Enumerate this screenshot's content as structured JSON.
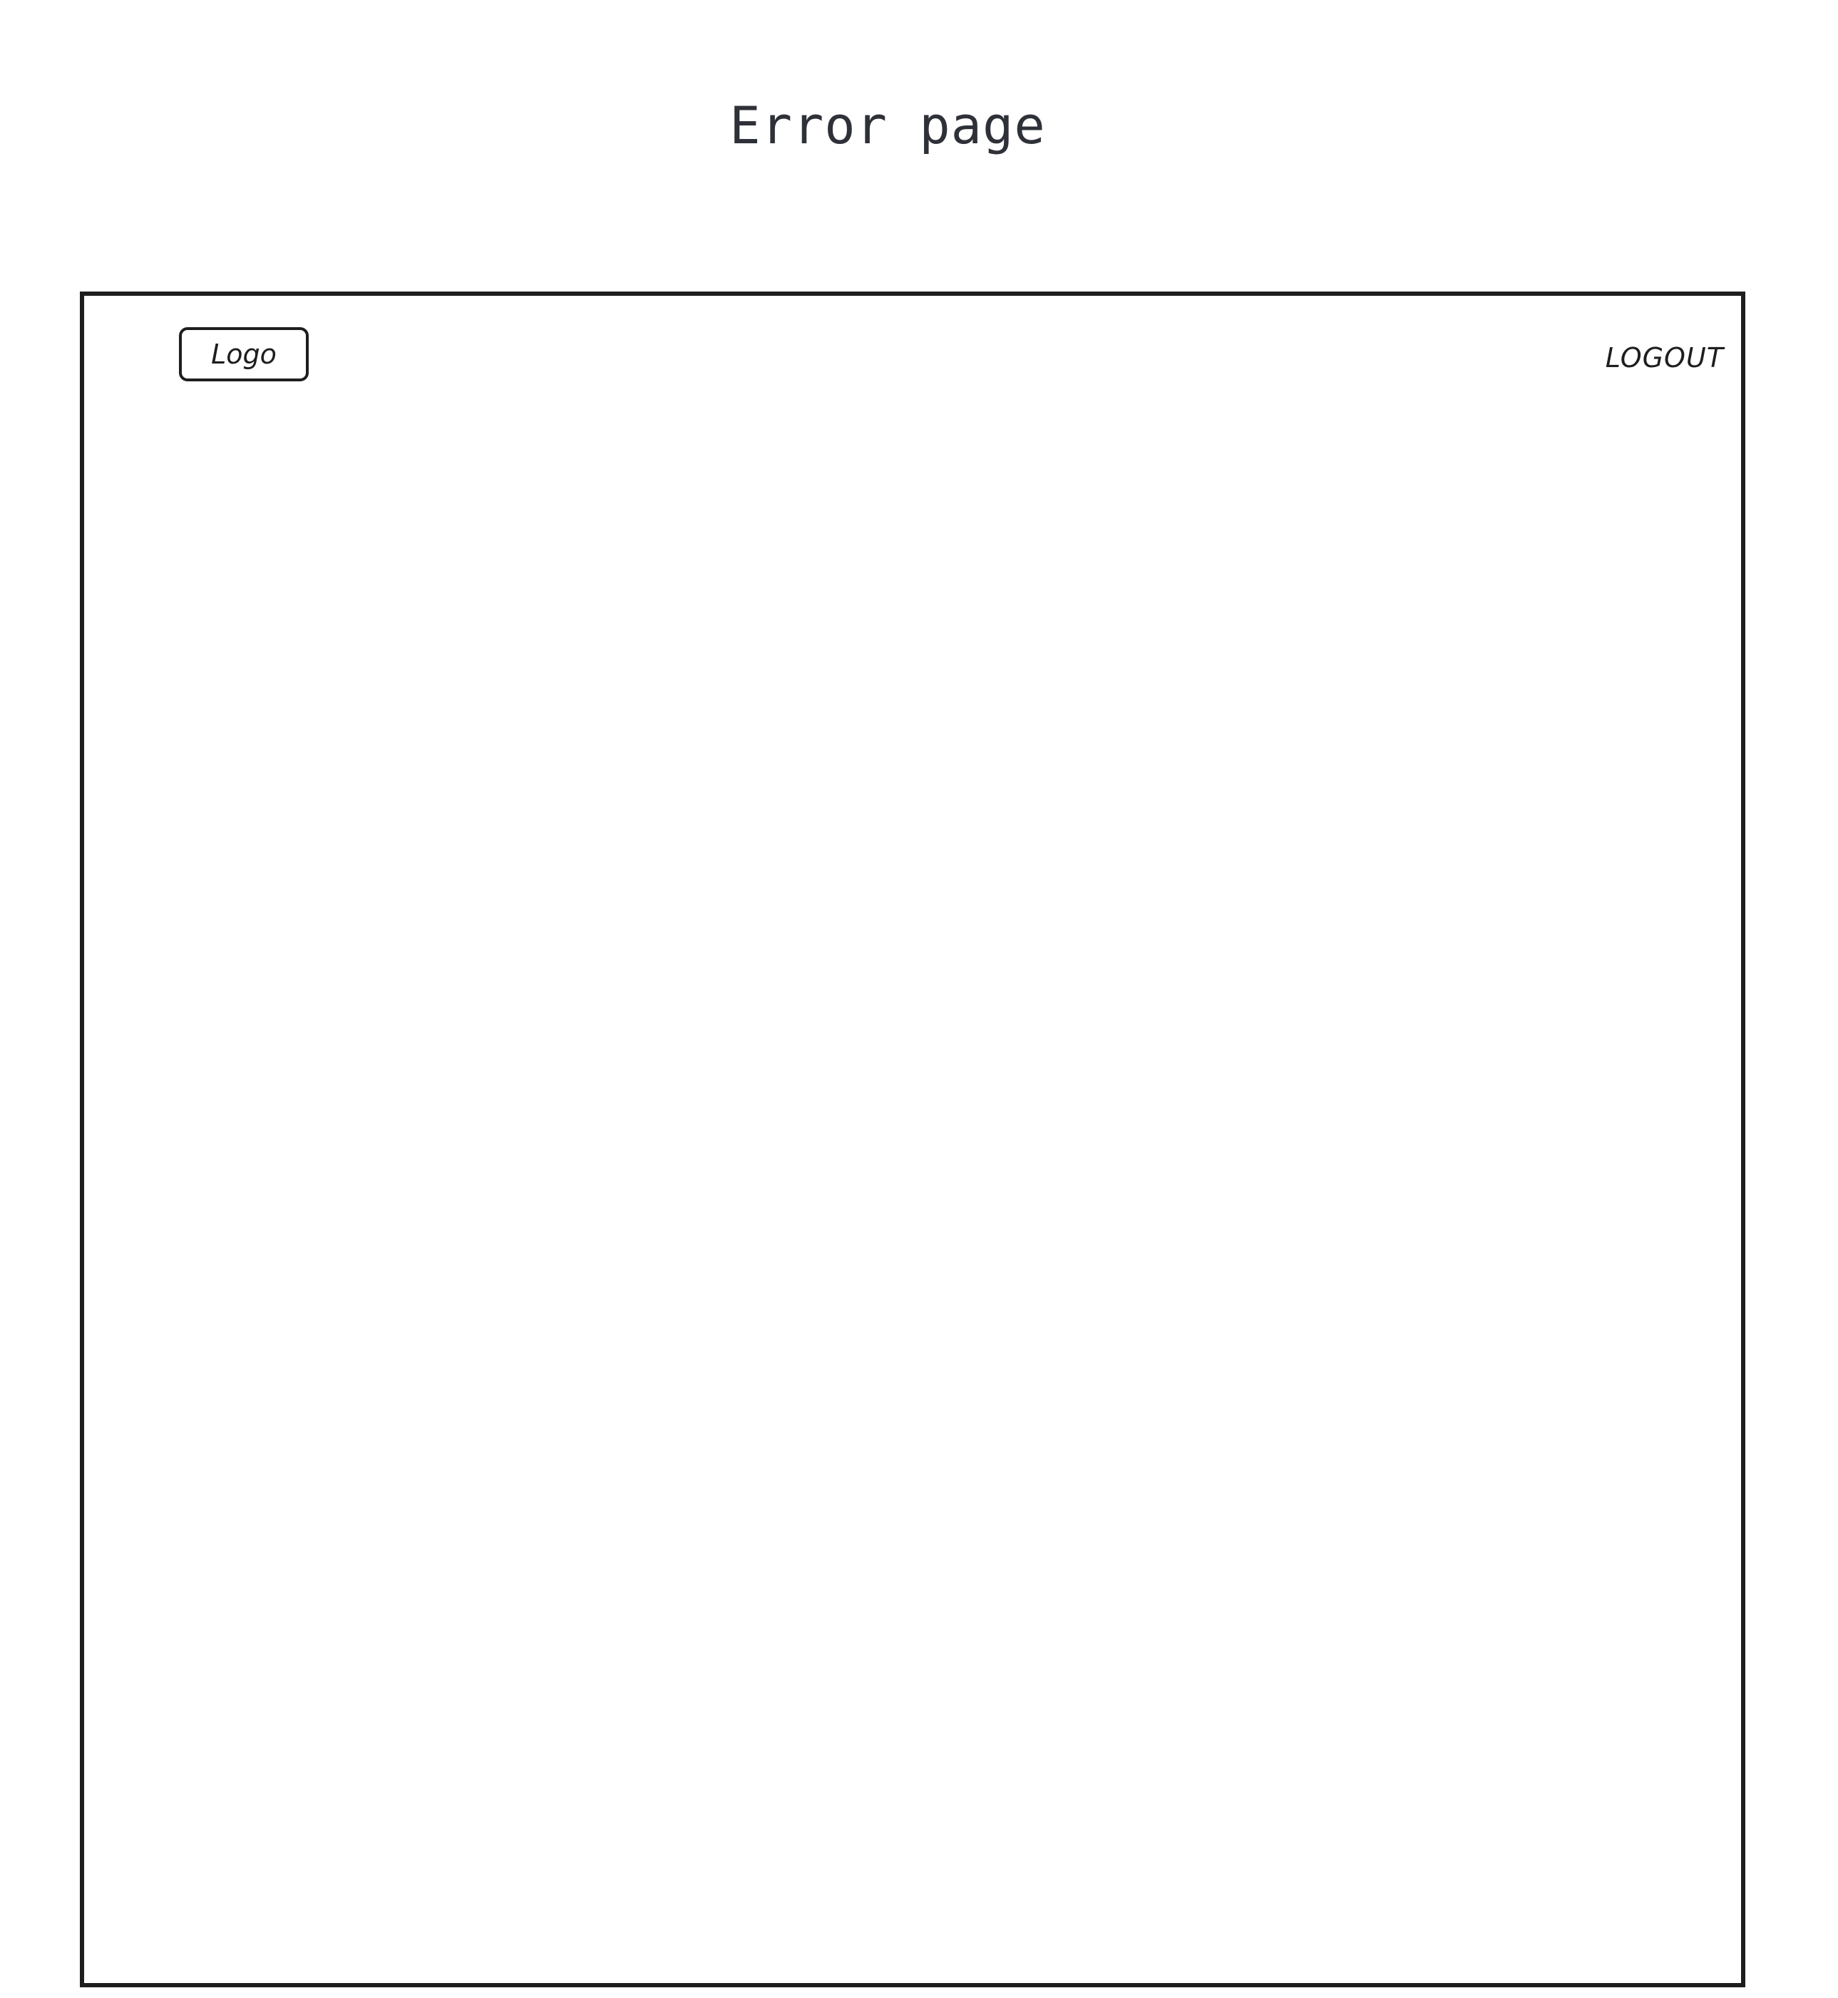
{
  "page": {
    "title": "Error page"
  },
  "header": {
    "logo_label": "Logo",
    "logout_label": "LOGOUT"
  },
  "colors": {
    "stroke": "#1e1e1e",
    "title_text": "#2e3138",
    "background": "#ffffff"
  }
}
